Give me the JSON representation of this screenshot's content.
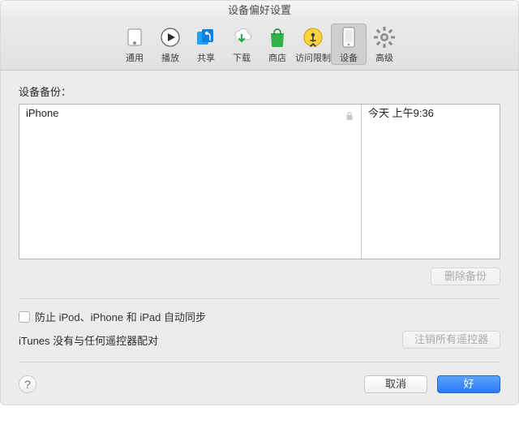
{
  "window": {
    "title": "设备偏好设置"
  },
  "toolbar": {
    "general": {
      "label": "通用"
    },
    "playback": {
      "label": "播放"
    },
    "sharing": {
      "label": "共享"
    },
    "downloads": {
      "label": "下载"
    },
    "store": {
      "label": "商店"
    },
    "parental": {
      "label": "访问限制"
    },
    "devices": {
      "label": "设备",
      "selected": true
    },
    "advanced": {
      "label": "高级"
    }
  },
  "backups": {
    "label": "设备备份：",
    "rows": [
      {
        "device": "iPhone",
        "locked": true,
        "time": "今天 上午9:36"
      }
    ],
    "delete_label": "删除备份"
  },
  "options": {
    "prevent_sync_label": "防止 iPod、iPhone 和 iPad 自动同步",
    "prevent_sync_checked": false,
    "remote_pair_text": "iTunes 没有与任何遥控器配对",
    "deauthorize_label": "注销所有遥控器"
  },
  "footer": {
    "help_glyph": "?",
    "cancel_label": "取消",
    "ok_label": "好"
  }
}
